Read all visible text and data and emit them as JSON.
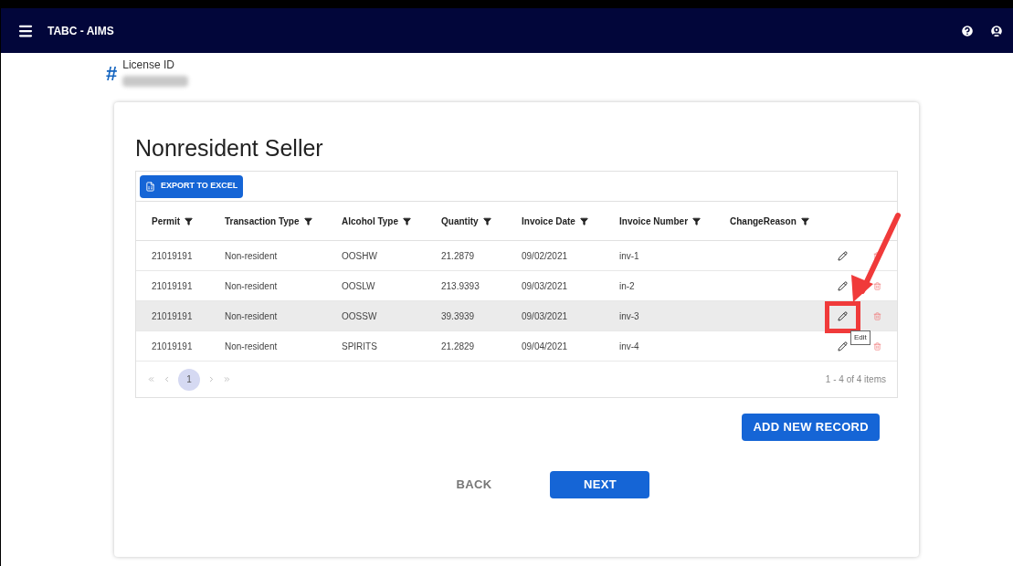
{
  "app_bar": {
    "title": "TABC - AIMS"
  },
  "license": {
    "icon": "#",
    "label": "License ID"
  },
  "card": {
    "title": "Nonresident Seller",
    "export_button": "EXPORT TO EXCEL"
  },
  "table": {
    "columns": [
      "Permit",
      "Transaction Type",
      "Alcohol Type",
      "Quantity",
      "Invoice Date",
      "Invoice Number",
      "ChangeReason"
    ],
    "rows": [
      {
        "cells": [
          "21019191",
          "Non-resident",
          "OOSHW",
          "21.2879",
          "09/02/2021",
          "inv-1",
          ""
        ],
        "selected": false
      },
      {
        "cells": [
          "21019191",
          "Non-resident",
          "OOSLW",
          "213.9393",
          "09/03/2021",
          "in-2",
          ""
        ],
        "selected": false
      },
      {
        "cells": [
          "21019191",
          "Non-resident",
          "OOSSW",
          "39.3939",
          "09/03/2021",
          "inv-3",
          ""
        ],
        "selected": true
      },
      {
        "cells": [
          "21019191",
          "Non-resident",
          "SPIRITS",
          "21.2829",
          "09/04/2021",
          "inv-4",
          ""
        ],
        "selected": false
      }
    ]
  },
  "pager": {
    "pages": [
      {
        "label": "1",
        "selected": true
      }
    ],
    "summary": "1 - 4 of 4 items"
  },
  "tooltip": "Edit",
  "buttons": {
    "add": "ADD NEW RECORD",
    "back": "BACK",
    "next": "NEXT"
  }
}
